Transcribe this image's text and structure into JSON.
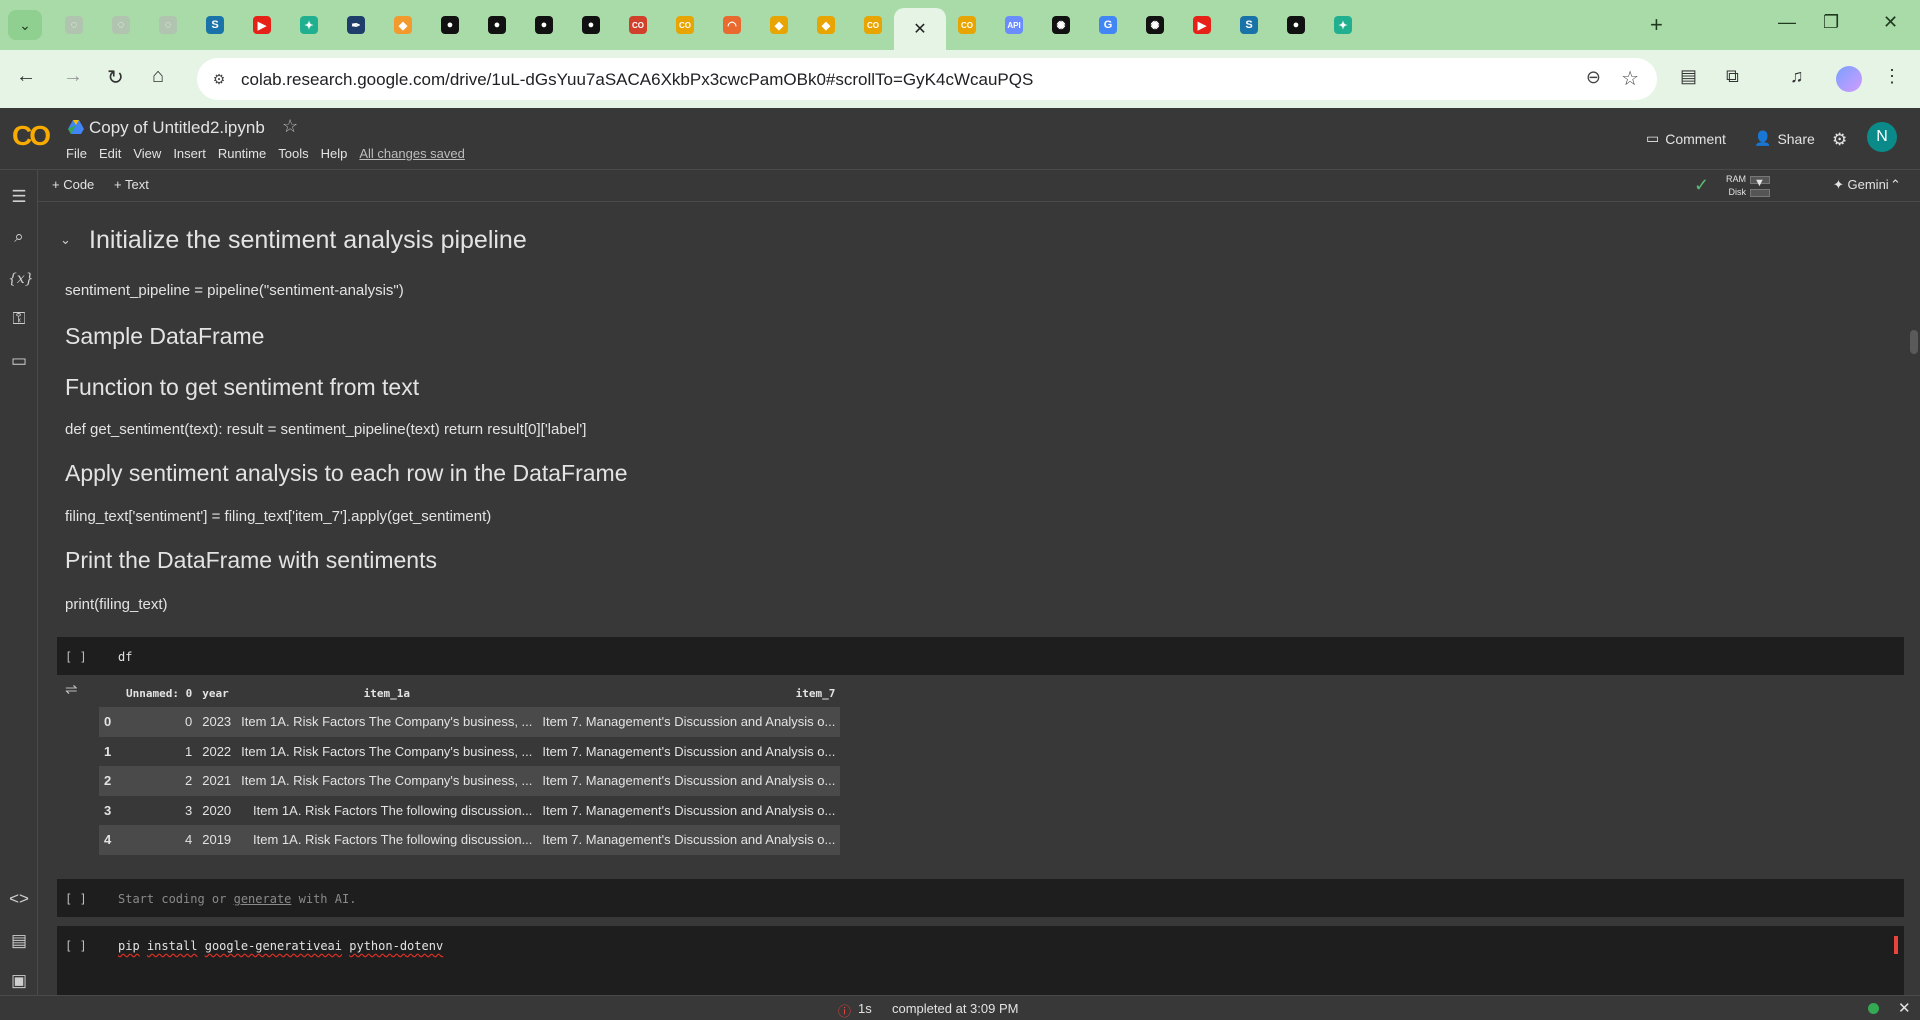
{
  "browser": {
    "tabs": [
      {
        "name": "tab-favicon-generic",
        "glyph": "◌",
        "color": "#b0c4b0"
      },
      {
        "name": "tab-favicon-generic",
        "glyph": "◌",
        "color": "#b0c4b0"
      },
      {
        "name": "tab-favicon-generic",
        "glyph": "◌",
        "color": "#b0c4b0"
      },
      {
        "name": "tab-favicon-s",
        "glyph": "S",
        "color": "#1a73a8"
      },
      {
        "name": "tab-favicon-youtube",
        "glyph": "▶",
        "color": "#e62117"
      },
      {
        "name": "tab-favicon-chat",
        "glyph": "✦",
        "color": "#20b090"
      },
      {
        "name": "tab-favicon-pen",
        "glyph": "✒",
        "color": "#1e3d6b"
      },
      {
        "name": "tab-favicon-box",
        "glyph": "◆",
        "color": "#f29a2e"
      },
      {
        "name": "tab-favicon-github",
        "glyph": "●",
        "color": "#111111"
      },
      {
        "name": "tab-favicon-github",
        "glyph": "●",
        "color": "#111111"
      },
      {
        "name": "tab-favicon-github",
        "glyph": "●",
        "color": "#111111"
      },
      {
        "name": "tab-favicon-github",
        "glyph": "●",
        "color": "#111111"
      },
      {
        "name": "tab-favicon-colab",
        "glyph": "CO",
        "color": "#d0402b"
      },
      {
        "name": "tab-favicon-colab",
        "glyph": "CO",
        "color": "#e8a400"
      },
      {
        "name": "tab-favicon-loader",
        "glyph": "◠",
        "color": "#e86a2e"
      },
      {
        "name": "tab-favicon-colab",
        "glyph": "◆",
        "color": "#e8a400"
      },
      {
        "name": "tab-favicon-colab",
        "glyph": "◆",
        "color": "#e8a400"
      },
      {
        "name": "tab-favicon-colab",
        "glyph": "CO",
        "color": "#e8a400"
      },
      {
        "name": "tab-active-close",
        "glyph": "✕",
        "color": "#222222",
        "active": true
      },
      {
        "name": "tab-favicon-colab",
        "glyph": "CO",
        "color": "#e8a400"
      },
      {
        "name": "tab-favicon-api",
        "glyph": "API",
        "color": "#6a8cff"
      },
      {
        "name": "tab-favicon-openai",
        "glyph": "✺",
        "color": "#111111"
      },
      {
        "name": "tab-favicon-google",
        "glyph": "G",
        "color": "#4285f4"
      },
      {
        "name": "tab-favicon-openai",
        "glyph": "✺",
        "color": "#111111"
      },
      {
        "name": "tab-favicon-youtube",
        "glyph": "▶",
        "color": "#e62117"
      },
      {
        "name": "tab-favicon-s",
        "glyph": "S",
        "color": "#1a73a8"
      },
      {
        "name": "tab-favicon-github",
        "glyph": "●",
        "color": "#111111"
      },
      {
        "name": "tab-favicon-chat",
        "glyph": "✦",
        "color": "#20b090"
      }
    ],
    "url": "colab.research.google.com/drive/1uL-dGsYuu7aSACA6XkbPx3cwcPamOBk0#scrollTo=GyK4cWcauPQS"
  },
  "colab": {
    "notebook_title": "Copy of Untitled2.ipynb",
    "menu": [
      "File",
      "Edit",
      "View",
      "Insert",
      "Runtime",
      "Tools",
      "Help"
    ],
    "saved_status": "All changes saved",
    "comment_label": "Comment",
    "share_label": "Share",
    "avatar_letter": "N",
    "add_code_label": "+ Code",
    "add_text_label": "+ Text",
    "ram_label": "RAM",
    "disk_label": "Disk",
    "gemini_label": "Gemini"
  },
  "notebook": {
    "section_heading": "Initialize the sentiment analysis pipeline",
    "md_line1": "sentiment_pipeline = pipeline(\"sentiment-analysis\")",
    "md_h_sample": "Sample DataFrame",
    "md_h_function": "Function to get sentiment from text",
    "md_line2": "def get_sentiment(text): result = sentiment_pipeline(text) return result[0]['label']",
    "md_h_apply": "Apply sentiment analysis to each row in the DataFrame",
    "md_line3": "filing_text['sentiment'] = filing_text['item_7'].apply(get_sentiment)",
    "md_h_print": "Print the DataFrame with sentiments",
    "md_line4": "print(filing_text)",
    "cell1_run": "[ ]",
    "cell1_code": "df",
    "cell2_run": "[ ]",
    "cell2_placeholder_pre": "Start coding or ",
    "cell2_placeholder_link": "generate",
    "cell2_placeholder_post": " with AI.",
    "cell3_run": "[ ]",
    "cell3_code_pip": "pip",
    "cell3_code_install": "install",
    "cell3_code_pkg1": "google-generativeai",
    "cell3_code_pkg2": "python-dotenv"
  },
  "dataframe": {
    "columns": [
      "",
      "Unnamed: 0",
      "year",
      "item_1a",
      "item_7"
    ],
    "rows": [
      [
        "0",
        "0",
        "2023",
        "Item 1A. Risk Factors The Company's business, ...",
        "Item 7. Management's Discussion and Analysis o..."
      ],
      [
        "1",
        "1",
        "2022",
        "Item 1A. Risk Factors The Company's business, ...",
        "Item 7. Management's Discussion and Analysis o..."
      ],
      [
        "2",
        "2",
        "2021",
        "Item 1A. Risk Factors The Company's business, ...",
        "Item 7. Management's Discussion and Analysis o..."
      ],
      [
        "3",
        "3",
        "2020",
        "Item 1A. Risk Factors The following discussion...",
        "Item 7. Management's Discussion and Analysis o..."
      ],
      [
        "4",
        "4",
        "2019",
        "Item 1A. Risk Factors The following discussion...",
        "Item 7. Management's Discussion and Analysis o..."
      ]
    ]
  },
  "status": {
    "exec_time": "1s",
    "completed": "completed at 3:09 PM"
  },
  "colors": {
    "accent": "#f9ab00",
    "tabstrip": "#a8dba8",
    "toolbar": "#e6f4e6",
    "notebook_bg": "#383838",
    "code_bg": "#1e1e1e",
    "ok_green": "#34a853",
    "error_red": "#e8453c"
  }
}
